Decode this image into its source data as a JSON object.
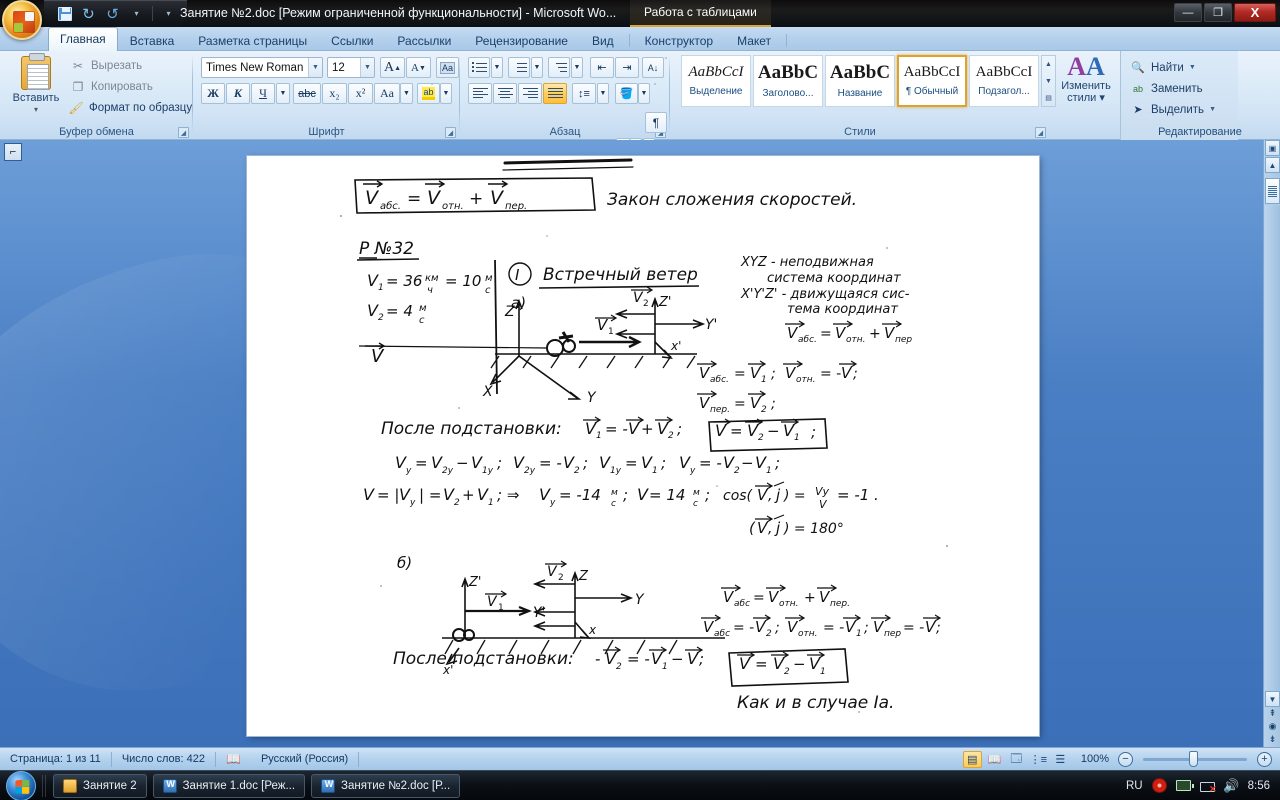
{
  "titlebar": {
    "document_title": "Занятие №2.doc [Режим ограниченной функциональности] - Microsoft Wo...",
    "contextual_tab": "Работа с таблицами",
    "quick_access": [
      "save-icon",
      "undo-icon",
      "redo-icon",
      "customize-icon"
    ],
    "window_buttons": {
      "minimize": "—",
      "restore": "❐",
      "close": "X"
    }
  },
  "tabs": [
    {
      "label": "Главная",
      "active": true
    },
    {
      "label": "Вставка",
      "active": false
    },
    {
      "label": "Разметка страницы",
      "active": false
    },
    {
      "label": "Ссылки",
      "active": false
    },
    {
      "label": "Рассылки",
      "active": false
    },
    {
      "label": "Рецензирование",
      "active": false
    },
    {
      "label": "Вид",
      "active": false
    },
    {
      "label": "Конструктор",
      "active": false
    },
    {
      "label": "Макет",
      "active": false
    }
  ],
  "ribbon": {
    "clipboard": {
      "title": "Буфер обмена",
      "paste_label": "Вставить",
      "cut_label": "Вырезать",
      "copy_label": "Копировать",
      "format_painter_label": "Формат по образцу"
    },
    "font": {
      "title": "Шрифт",
      "font_name": "Times New Roman",
      "font_size": "12",
      "grow_label": "A",
      "shrink_label": "A",
      "clear_format_label": "Aa",
      "bold_label": "Ж",
      "italic_label": "К",
      "underline_label": "Ч",
      "strike_label": "abc",
      "subscript_label": "x₂",
      "superscript_label": "x²",
      "change_case_label": "Aa",
      "highlight_label": "ab",
      "font_color_label": "A"
    },
    "paragraph": {
      "title": "Абзац",
      "bullets": "bullet-list-icon",
      "numbering": "numbered-list-icon",
      "multilevel": "multilevel-list-icon",
      "decrease_indent": "decrease-indent-icon",
      "increase_indent": "increase-indent-icon",
      "sort": "sort-icon",
      "show_marks": "¶",
      "align_left": "align-left-icon",
      "align_center": "align-center-icon",
      "align_right": "align-right-icon",
      "align_justify": "align-justify-icon",
      "line_spacing": "line-spacing-icon",
      "shading": "shading-icon",
      "borders": "borders-icon"
    },
    "styles": {
      "title": "Стили",
      "change_styles_label": "Изменить\nстили",
      "gallery": [
        {
          "sample": "AaBbCcI",
          "name": "Выделение",
          "selected": false,
          "italic": true
        },
        {
          "sample": "AaBbC",
          "name": "Заголово...",
          "selected": false,
          "bold": true
        },
        {
          "sample": "AaBbC",
          "name": "Название",
          "selected": false,
          "bold": true
        },
        {
          "sample": "AaBbCcI",
          "name": "¶ Обычный",
          "selected": true
        },
        {
          "sample": "AaBbCcI",
          "name": "Подзагол...",
          "selected": false
        }
      ]
    },
    "editing": {
      "title": "Редактирование",
      "find_label": "Найти",
      "replace_label": "Заменить",
      "select_label": "Выделить"
    }
  },
  "document": {
    "page_background": "#ffffff",
    "content_kind": "scanned-handwritten-physics-notes",
    "handwritten_lines": [
      "V абс. = V отн. + V пер.   Закон сложения скоростей.",
      "Р №32",
      "V₁ = 36 км/ч = 10 м/с",
      "V₂ = 4 м/с",
      "V",
      "Ⅰ  Встречный ветер",
      "а)",
      "XYZ - неподвижная система координат",
      "X'Y'Z' - движущаяся система координат",
      "V абс. = V отн. + V пер.",
      "V абс. = V₁ ;  V отн. = -V ;",
      "V пер. = V₂ ;",
      "После подстановки:  V₁ = -V + V₂ ;",
      "V = V₂ - V₁ ;",
      "Vy = V₂y - V₁y ;  V₂y = -V₂ ;  V₁y = V₁ ;  Vy = -V₂ - V₁ ;",
      "V = |Vy| = V₂ + V₁ ;  ⇒ Vy = -14 м/с ;  V = 14 м/с ;  cos(V,j) = Vy/V = -1 .",
      "(V,j) = 180°",
      "б)",
      "V абс. = V отн. + V пер.",
      "V абс. = -V₂ ;  V отн. = -V₁ ;  V пер. = -V ;",
      "После подстановки:  -V₂ = -V₁ - V ;",
      "V = V₂ - V₁",
      "Как и в случае Ⅰа."
    ]
  },
  "statusbar": {
    "page_info": "Страница: 1 из 11",
    "word_count": "Число слов: 422",
    "proofing_icon": "spelling-check-icon",
    "language": "Русский (Россия)",
    "zoom_level": "100%",
    "zoom_out": "−",
    "zoom_in": "+",
    "view_buttons": [
      "print-layout-icon",
      "full-screen-reading-icon",
      "web-layout-icon",
      "outline-icon",
      "draft-icon"
    ]
  },
  "taskbar": {
    "start": "start-orb-icon",
    "items": [
      {
        "icon": "folder-icon",
        "label": "Занятие 2"
      },
      {
        "icon": "word-icon",
        "label": "Занятие 1.doc [Реж..."
      },
      {
        "icon": "word-icon",
        "label": "Занятие №2.doc [Р..."
      }
    ],
    "tray": {
      "language": "RU",
      "icons": [
        "record-icon",
        "battery-icon",
        "network-disconnected-icon",
        "volume-icon"
      ],
      "clock": "8:56"
    }
  }
}
